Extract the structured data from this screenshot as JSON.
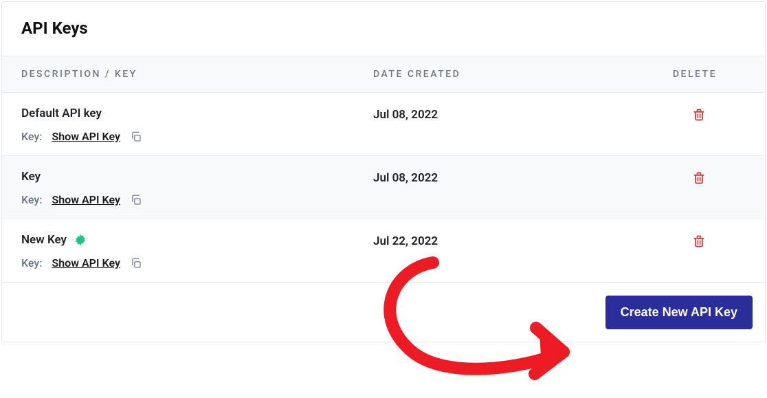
{
  "header": {
    "title": "API Keys"
  },
  "table": {
    "columns": {
      "desc": "DESCRIPTION / KEY",
      "date": "DATE CREATED",
      "delete": "DELETE"
    },
    "key_prefix": "Key:",
    "show_label": "Show API Key",
    "rows": [
      {
        "name": "Default API key",
        "date": "Jul 08, 2022",
        "is_new": false
      },
      {
        "name": "Key",
        "date": "Jul 08, 2022",
        "is_new": false
      },
      {
        "name": "New Key",
        "date": "Jul 22, 2022",
        "is_new": true
      }
    ]
  },
  "footer": {
    "create_label": "Create New API Key"
  },
  "colors": {
    "primary": "#2b2e9a",
    "danger": "#c53434",
    "new_badge": "#26c281",
    "annotation": "#ed1c24"
  }
}
